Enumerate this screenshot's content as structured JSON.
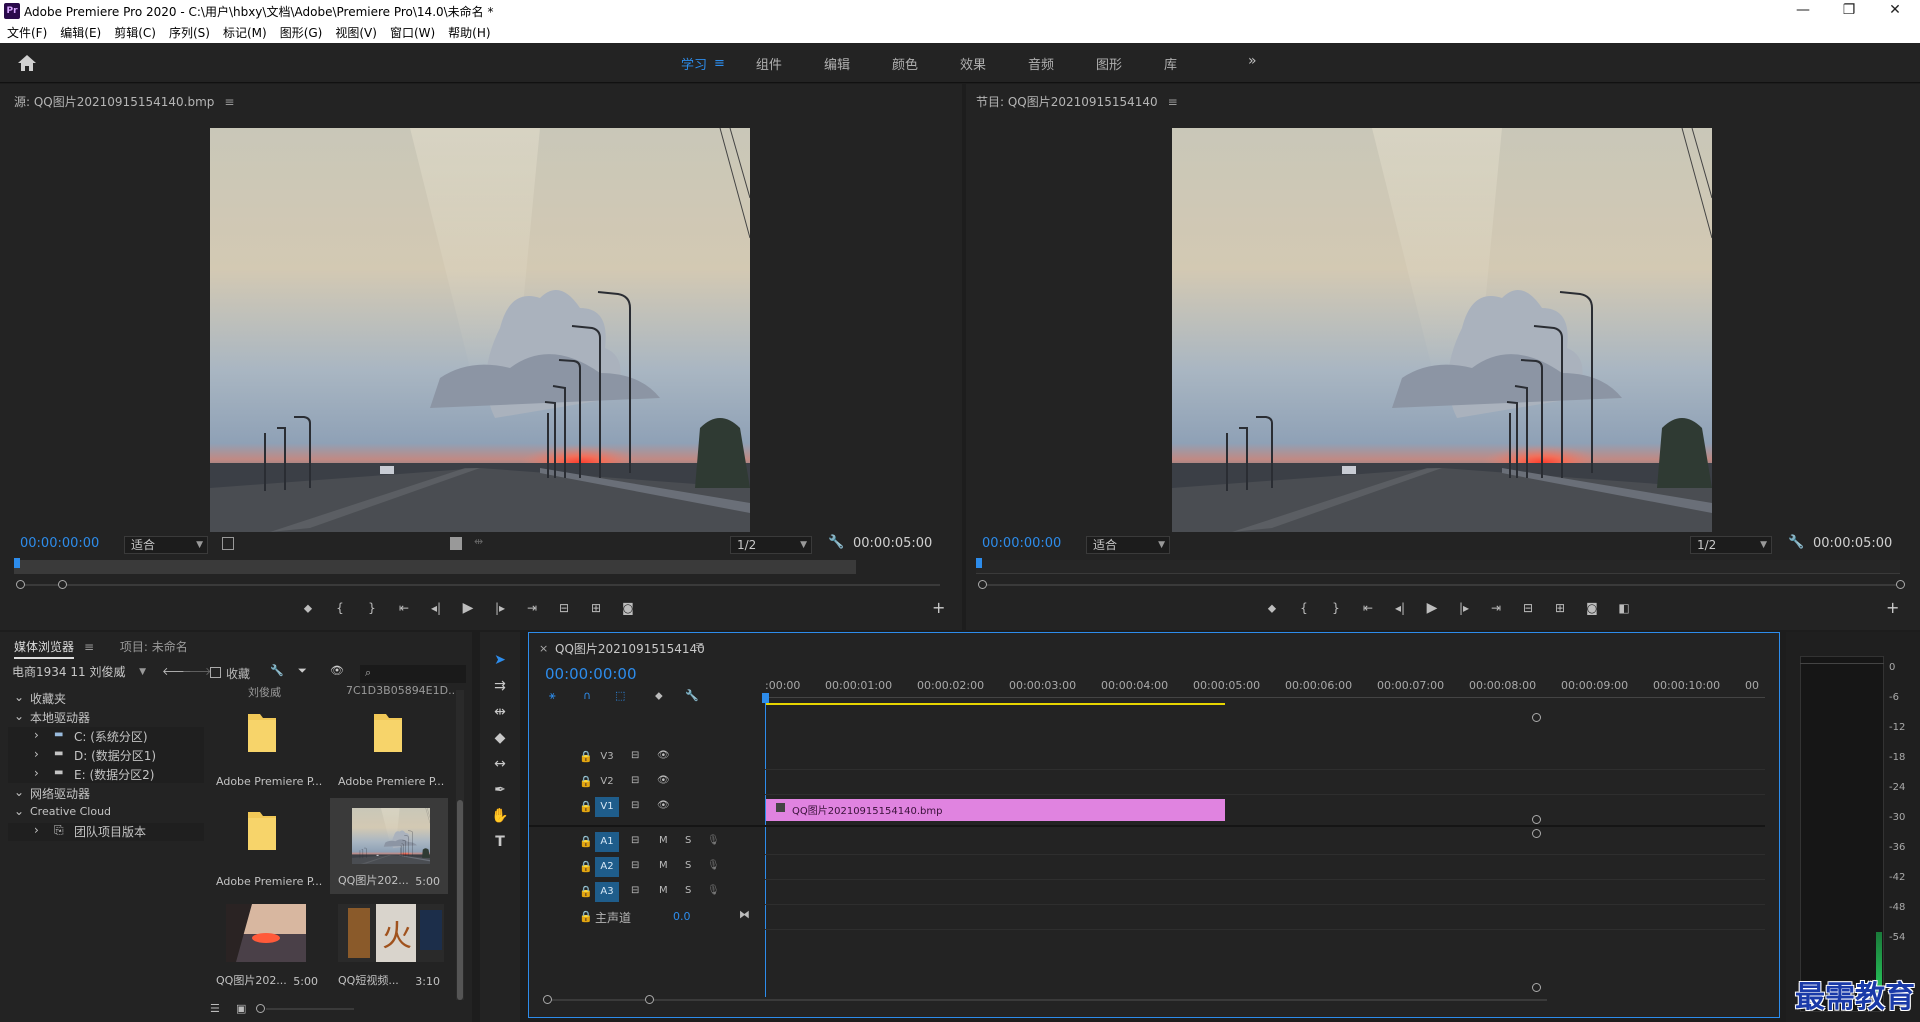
{
  "window": {
    "title": "Adobe Premiere Pro 2020 - C:\\用户\\hbxy\\文档\\Adobe\\Premiere Pro\\14.0\\未命名 *",
    "logo": "Pr"
  },
  "menu": [
    "文件(F)",
    "编辑(E)",
    "剪辑(C)",
    "序列(S)",
    "标记(M)",
    "图形(G)",
    "视图(V)",
    "窗口(W)",
    "帮助(H)"
  ],
  "workspaces": {
    "active": "学习",
    "tabs": [
      "学习",
      "组件",
      "编辑",
      "颜色",
      "效果",
      "音频",
      "图形",
      "库"
    ]
  },
  "source_monitor": {
    "title": "源: QQ图片20210915154140.bmp",
    "timecode": "00:00:00:00",
    "fit": "适合",
    "resolution": "1/2",
    "duration": "00:00:05:00"
  },
  "program_monitor": {
    "title": "节目: QQ图片20210915154140",
    "timecode": "00:00:00:00",
    "fit": "适合",
    "resolution": "1/2",
    "duration": "00:00:05:00"
  },
  "media_browser": {
    "tab_active": "媒体浏览器",
    "tab_project": "项目: 未命名",
    "location": "电商1934 11 刘俊威",
    "favorites_label": "收藏",
    "tree": {
      "favorites": "收藏夹",
      "local": "本地驱动器",
      "drives": [
        "C: (系统分区)",
        "D: (数据分区1)",
        "E: (数据分区2)"
      ],
      "network": "网络驱动器",
      "cloud": "Creative Cloud",
      "team": "团队项目版本"
    },
    "items": [
      {
        "label": "Adobe Premiere P...",
        "duration": ""
      },
      {
        "label": "Adobe Premiere P...",
        "duration": ""
      },
      {
        "label": "Adobe Premiere P...",
        "duration": ""
      },
      {
        "label": "QQ图片202...",
        "duration": "5:00"
      },
      {
        "label": "QQ图片202...",
        "duration": "5:00"
      },
      {
        "label": "QQ短视频...",
        "duration": "3:10"
      }
    ],
    "cut_labels": [
      "刘俊威",
      "7C1D3B05894E1D..."
    ]
  },
  "timeline": {
    "sequence": "QQ图片20210915154140",
    "timecode": "00:00:00:00",
    "ruler": [
      ":00:00",
      "00:00:01:00",
      "00:00:02:00",
      "00:00:03:00",
      "00:00:04:00",
      "00:00:05:00",
      "00:00:06:00",
      "00:00:07:00",
      "00:00:08:00",
      "00:00:09:00",
      "00:00:10:00",
      "00"
    ],
    "video_tracks": [
      "V3",
      "V2",
      "V1"
    ],
    "audio_tracks": [
      "A1",
      "A2",
      "A3"
    ],
    "mute_label": "M",
    "solo_label": "S",
    "master_label": "主声道",
    "master_value": "0.0",
    "clip_label": "QQ图片20210915154140.bmp",
    "clip_color": "#e083e0"
  },
  "meter": {
    "db": [
      "0",
      "-6",
      "-12",
      "-18",
      "-24",
      "-30",
      "-36",
      "-42",
      "-48",
      "-54"
    ]
  },
  "watermark": "最需教育",
  "colors": {
    "accent": "#2d8ceb",
    "clip": "#e083e0"
  }
}
